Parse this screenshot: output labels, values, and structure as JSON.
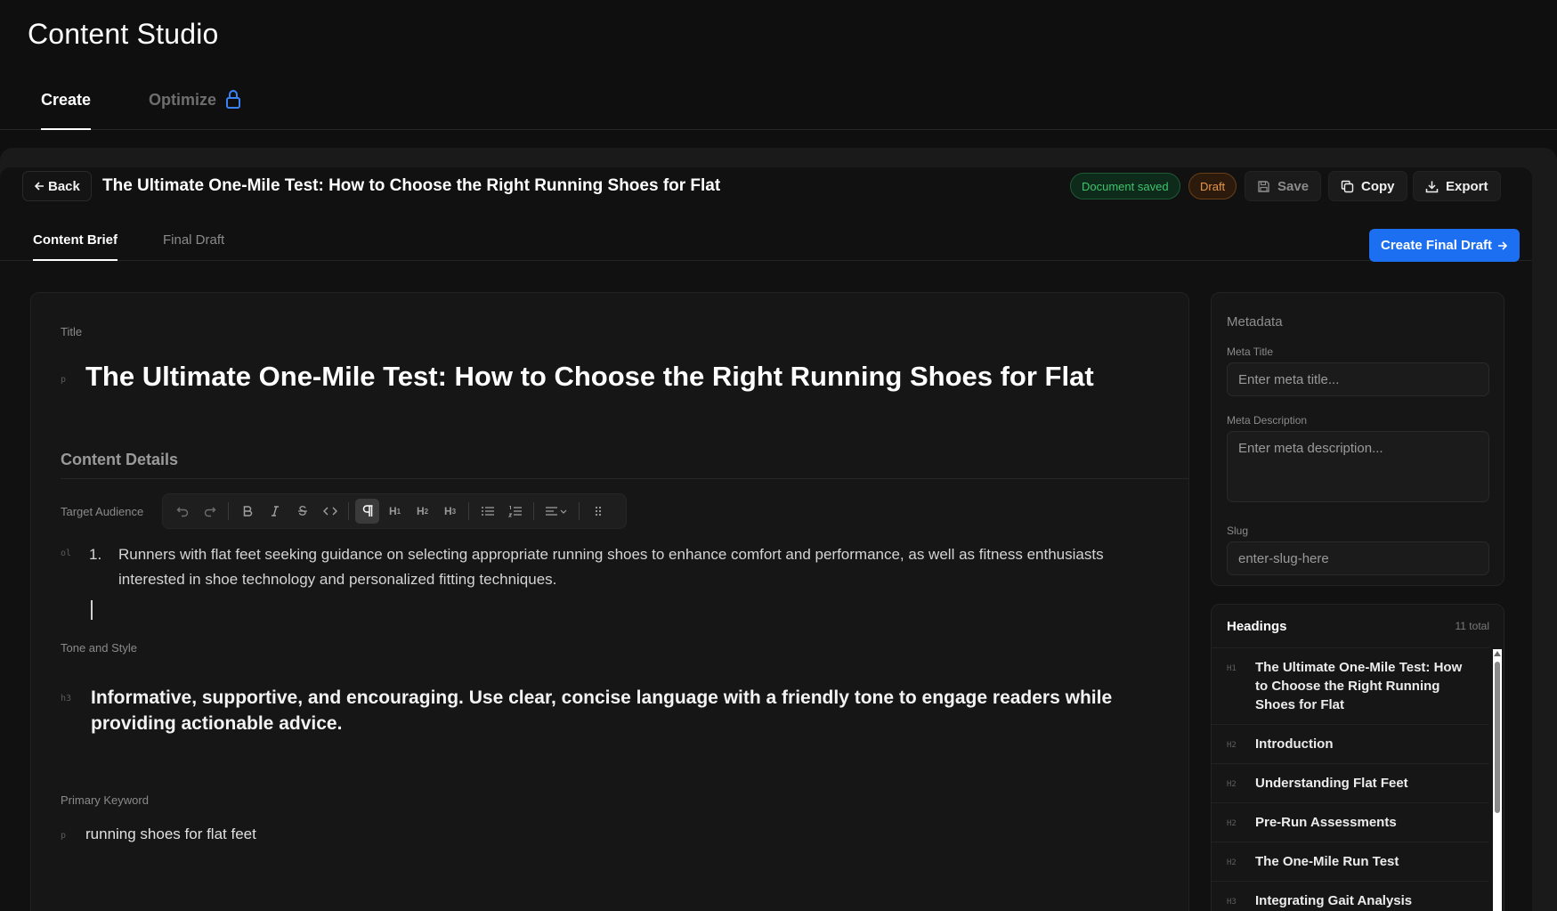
{
  "app": {
    "title": "Content Studio"
  },
  "top_tabs": {
    "create": "Create",
    "optimize": "Optimize"
  },
  "doc": {
    "back_label": "Back",
    "title": "The Ultimate One-Mile Test: How to Choose the Right Running Shoes for Flat",
    "status_saved": "Document saved",
    "status_draft": "Draft",
    "save_label": "Save",
    "copy_label": "Copy",
    "export_label": "Export"
  },
  "sub_tabs": {
    "brief": "Content Brief",
    "final": "Final Draft",
    "create_final": "Create Final Draft"
  },
  "editor": {
    "title_label": "Title",
    "title_tag": "p",
    "title_value": "The Ultimate One-Mile Test: How to Choose the Right Running Shoes for Flat",
    "details_heading": "Content Details",
    "audience_label": "Target Audience",
    "audience_tag": "ol",
    "audience_num": "1.",
    "audience_text": "Runners with flat feet seeking guidance on selecting appropriate running shoes to enhance comfort and performance, as well as fitness enthusiasts interested in shoe technology and personalized fitting techniques.",
    "tone_label": "Tone and Style",
    "tone_tag": "h3",
    "tone_text": "Informative, supportive, and encouraging. Use clear, concise language with a friendly tone to engage readers while providing actionable advice.",
    "keyword_label": "Primary Keyword",
    "keyword_tag": "p",
    "keyword_text": "running shoes for flat feet"
  },
  "toolbar": {
    "h1": "H",
    "h2": "H",
    "h3": "H",
    "h1_sub": "1",
    "h2_sub": "2",
    "h3_sub": "3"
  },
  "metadata": {
    "heading": "Metadata",
    "meta_title_label": "Meta Title",
    "meta_title_placeholder": "Enter meta title...",
    "meta_desc_label": "Meta Description",
    "meta_desc_placeholder": "Enter meta description...",
    "slug_label": "Slug",
    "slug_placeholder": "enter-slug-here"
  },
  "headings": {
    "title": "Headings",
    "count": "11 total",
    "items": [
      {
        "level": "H1",
        "text": "The Ultimate One-Mile Test: How to Choose the Right Running Shoes for Flat"
      },
      {
        "level": "H2",
        "text": "Introduction"
      },
      {
        "level": "H2",
        "text": "Understanding Flat Feet"
      },
      {
        "level": "H2",
        "text": "Pre-Run Assessments"
      },
      {
        "level": "H2",
        "text": "The One-Mile Run Test"
      },
      {
        "level": "H3",
        "text": "Integrating Gait Analysis"
      }
    ]
  },
  "colors": {
    "accent": "#1d6ff2",
    "saved": "#3ec46d",
    "draft": "#e6964a"
  }
}
